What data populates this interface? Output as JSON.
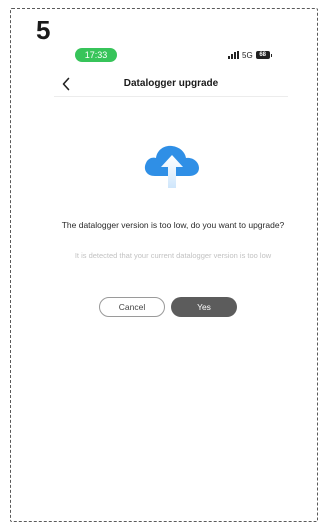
{
  "step": {
    "number": "5"
  },
  "status_bar": {
    "time": "17:33",
    "network": "5G",
    "battery": "68",
    "time_color": "#37c45a"
  },
  "header": {
    "title": "Datalogger upgrade",
    "back_icon": "chevron-left-icon"
  },
  "dialog": {
    "icon": "cloud-upload-icon",
    "icon_color": "#2f8fe6",
    "title": "The datalogger version is too low, do you want to upgrade?",
    "subtitle": "It is detected that your current datalogger version is too low"
  },
  "actions": {
    "cancel_label": "Cancel",
    "yes_label": "Yes",
    "yes_color": "#5c5c5c"
  }
}
